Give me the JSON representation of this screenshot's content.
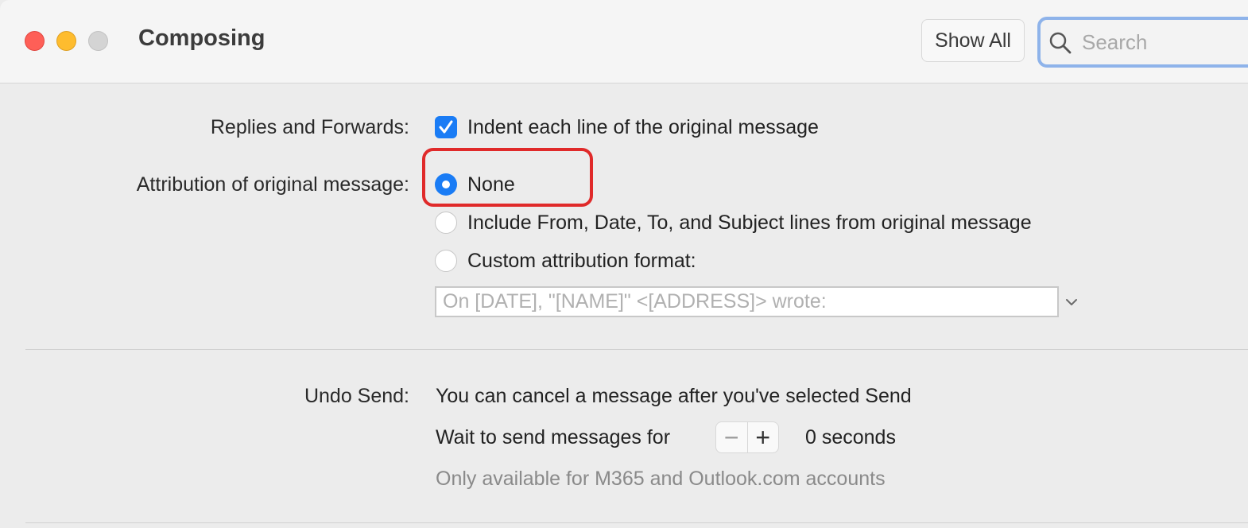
{
  "window": {
    "title": "Composing",
    "traffic_lights": [
      "close",
      "minimize",
      "zoom"
    ]
  },
  "toolbar": {
    "show_all_label": "Show All",
    "search_placeholder": "Search",
    "search_icon": "search-icon"
  },
  "replies": {
    "label": "Replies and Forwards:",
    "indent_checkbox_label": "Indent each line of the original message",
    "indent_checked": true
  },
  "attribution": {
    "label": "Attribution of original message:",
    "options": [
      {
        "label": "None",
        "selected": true
      },
      {
        "label": "Include From, Date, To, and Subject lines from original message",
        "selected": false
      },
      {
        "label": "Custom attribution format:",
        "selected": false
      }
    ],
    "custom_format_placeholder": "On [DATE], \"[NAME]\" <[ADDRESS]> wrote:"
  },
  "undo_send": {
    "label": "Undo Send:",
    "description": "You can cancel a message after you've selected Send",
    "wait_label": "Wait to send messages for",
    "stepper_minus": "−",
    "stepper_plus": "+",
    "seconds_value": "0 seconds",
    "note": "Only available for M365 and Outlook.com accounts"
  },
  "colors": {
    "accent": "#1a7cf5",
    "highlight_border": "#e02a2a",
    "close": "#fe5f57",
    "minimize": "#febc2e",
    "zoom_inactive": "#d4d4d4"
  }
}
